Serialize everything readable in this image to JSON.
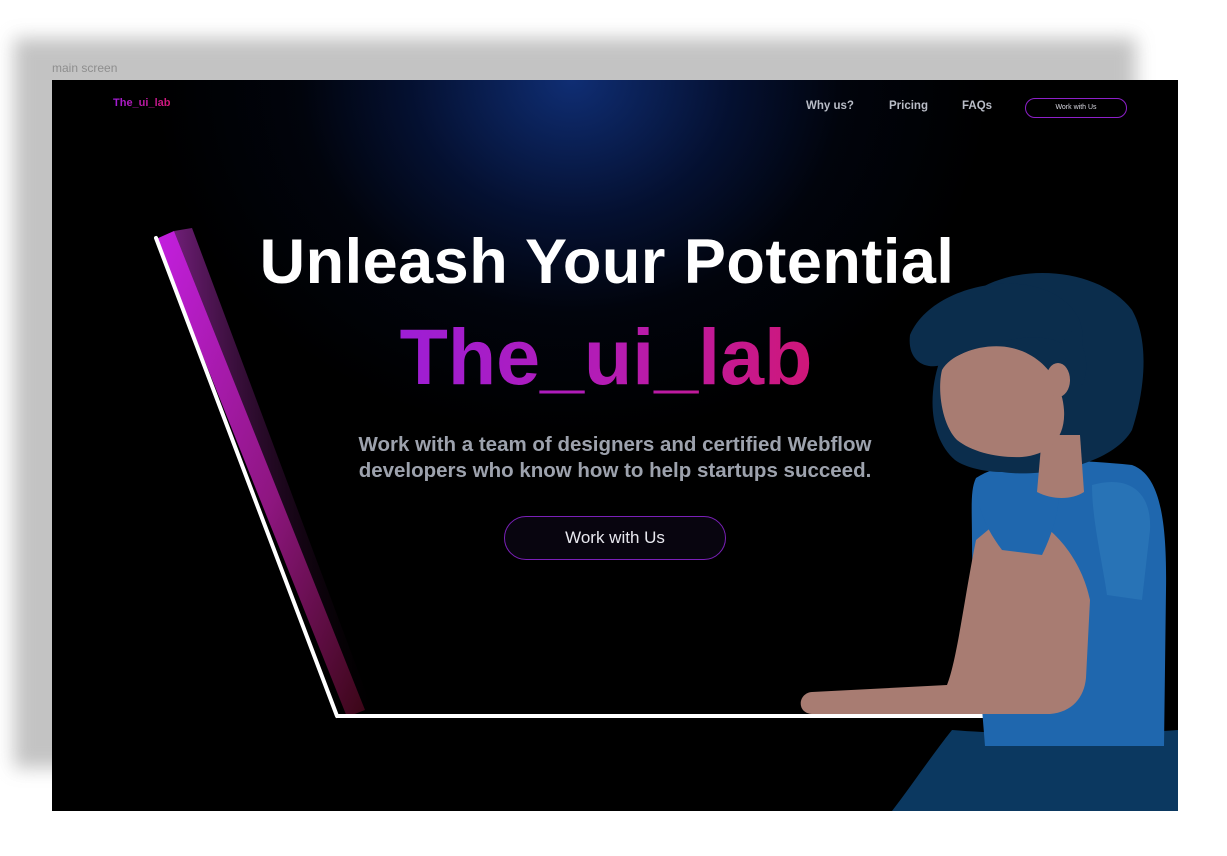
{
  "canvas": {
    "frame_label": "main screen"
  },
  "header": {
    "logo_text": "The_ui_lab",
    "nav_items": [
      "Why us?",
      "Pricing",
      "FAQs"
    ],
    "cta_label": "Work with Us"
  },
  "hero": {
    "title": "Unleash Your Potential",
    "brand": "The_ui_lab",
    "subtitle_line1": "Work with a team of designers and certified Webflow",
    "subtitle_line2": "developers who know how to help startups succeed.",
    "cta_label": "Work with Us"
  },
  "illustration": {
    "subject": "woman using laptop",
    "icons": [
      "laptop-screen-illustration",
      "woman-illustration"
    ]
  },
  "colors": {
    "background": "#000000",
    "glow": "#10307a",
    "accent_purple": "#9b1ed8",
    "accent_pink": "#d21673",
    "hair": "#0b2d4c",
    "skin": "#a87c72",
    "shirt": "#1f67ae"
  }
}
